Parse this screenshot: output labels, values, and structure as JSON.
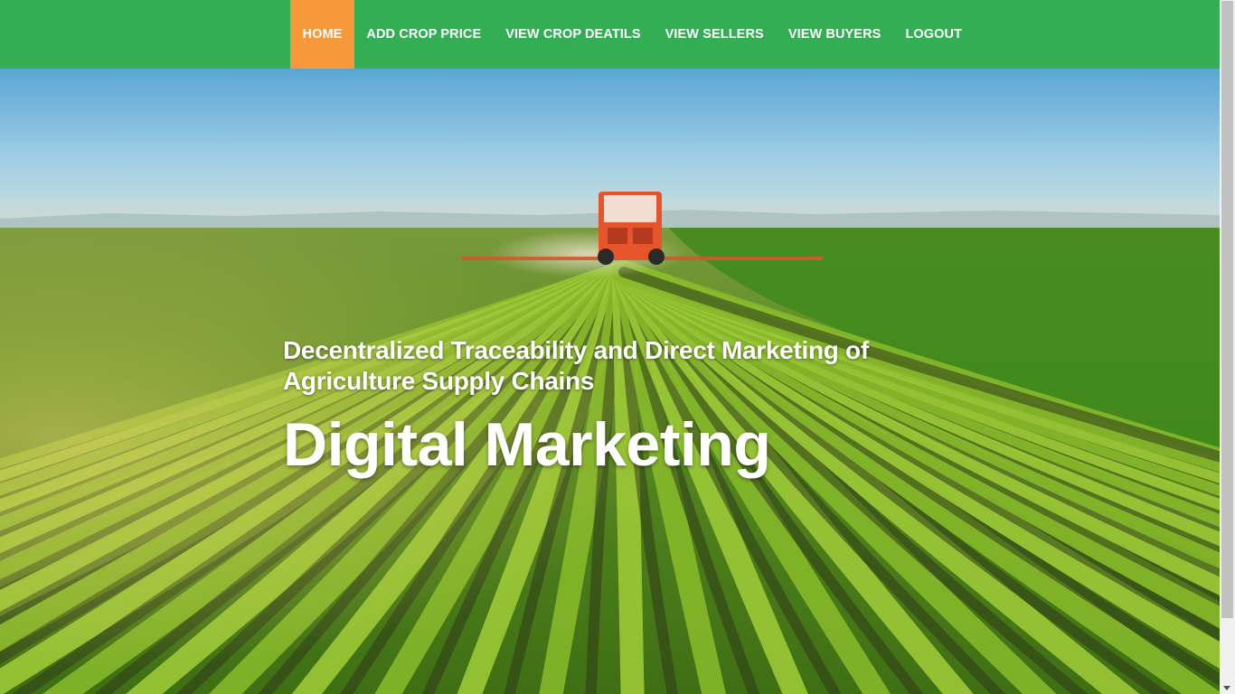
{
  "nav": {
    "items": [
      {
        "label": "HOME",
        "active": true
      },
      {
        "label": "ADD CROP PRICE",
        "active": false
      },
      {
        "label": "VIEW CROP DEATILS",
        "active": false
      },
      {
        "label": "VIEW SELLERS",
        "active": false
      },
      {
        "label": "VIEW BUYERS",
        "active": false
      },
      {
        "label": "LOGOUT",
        "active": false
      }
    ],
    "bar_color": "#33ae54",
    "active_color": "#f7983a"
  },
  "hero": {
    "subtitle": "Decentralized Traceability and Direct Marketing of Agriculture Supply Chains",
    "title": "Digital Marketing",
    "background": "farm-field-with-tractor-image"
  }
}
